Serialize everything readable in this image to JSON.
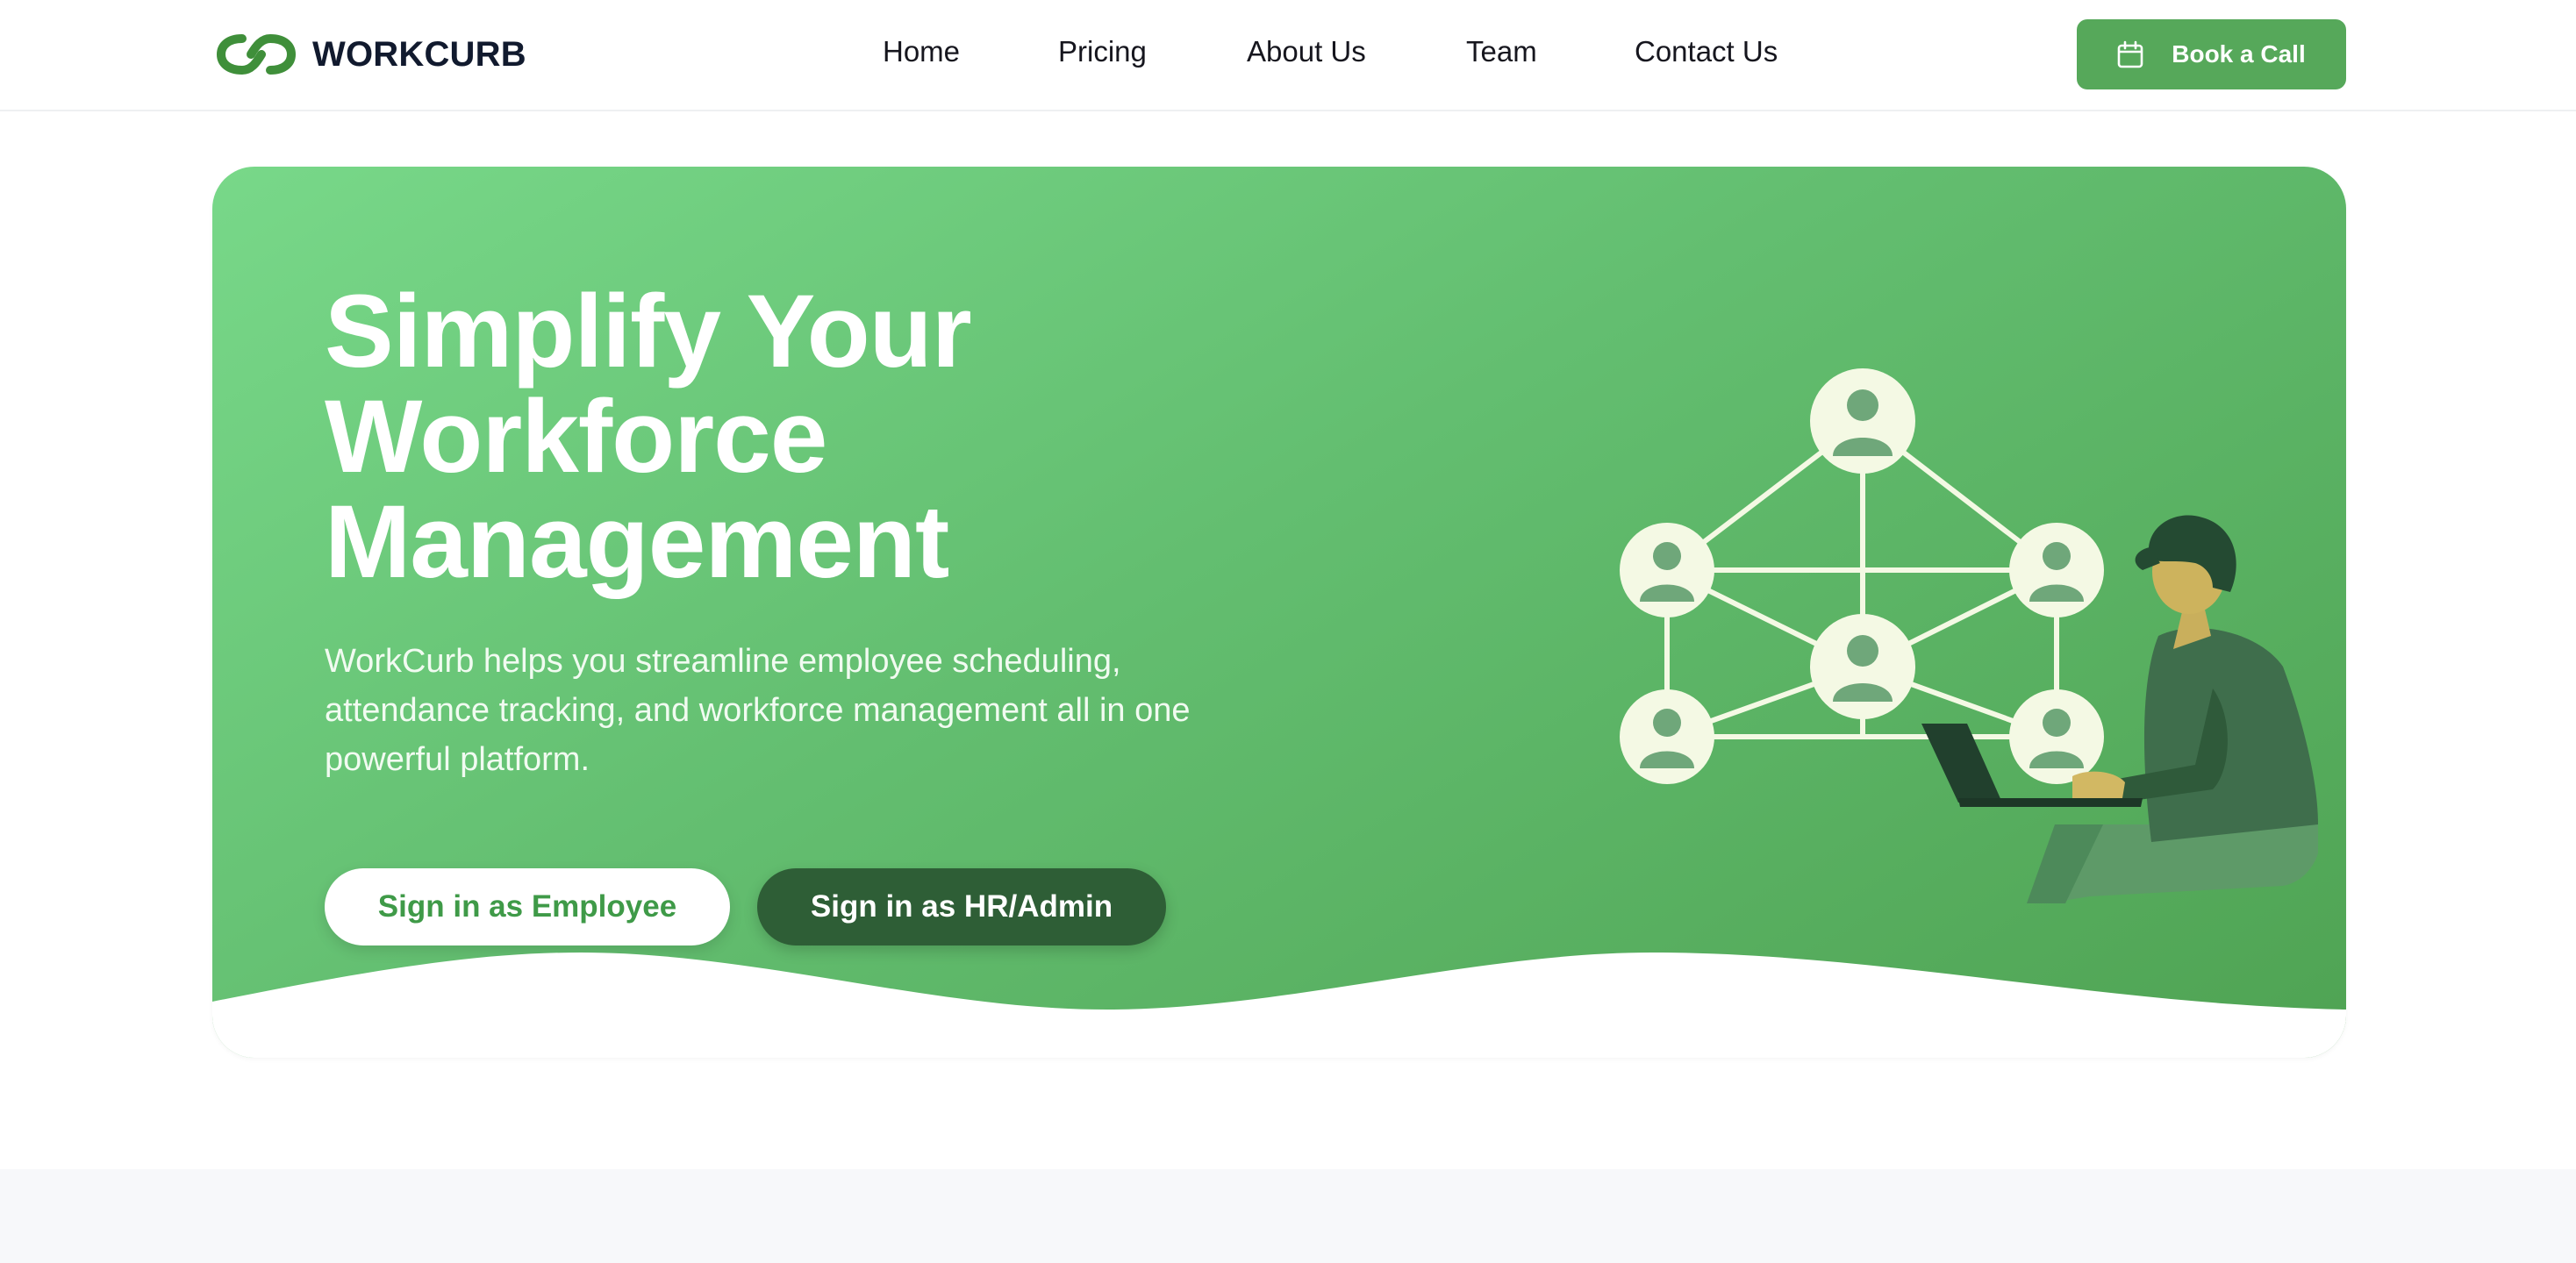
{
  "header": {
    "brand": "WORKCURB",
    "logo_icon": "infinity-link-icon",
    "nav": [
      {
        "label": "Home"
      },
      {
        "label": "Pricing"
      },
      {
        "label": "About Us"
      },
      {
        "label": "Team"
      },
      {
        "label": "Contact Us"
      }
    ],
    "cta": {
      "label": "Book a Call",
      "icon": "calendar-icon"
    }
  },
  "hero": {
    "title_lines": [
      "Simplify Your",
      "Workforce",
      "Management"
    ],
    "subtitle": "WorkCurb helps you streamline employee scheduling, attendance tracking, and workforce management all in one powerful platform.",
    "buttons": {
      "employee": "Sign in as Employee",
      "hr_admin": "Sign in as HR/Admin"
    },
    "illustration": "network-of-people-and-man-with-laptop"
  },
  "colors": {
    "brand_green": "#56a85a",
    "hero_gradient_start": "#78d889",
    "hero_gradient_end": "#4fa353",
    "dark_green": "#2e5e36",
    "text_dark": "#111a2e"
  }
}
